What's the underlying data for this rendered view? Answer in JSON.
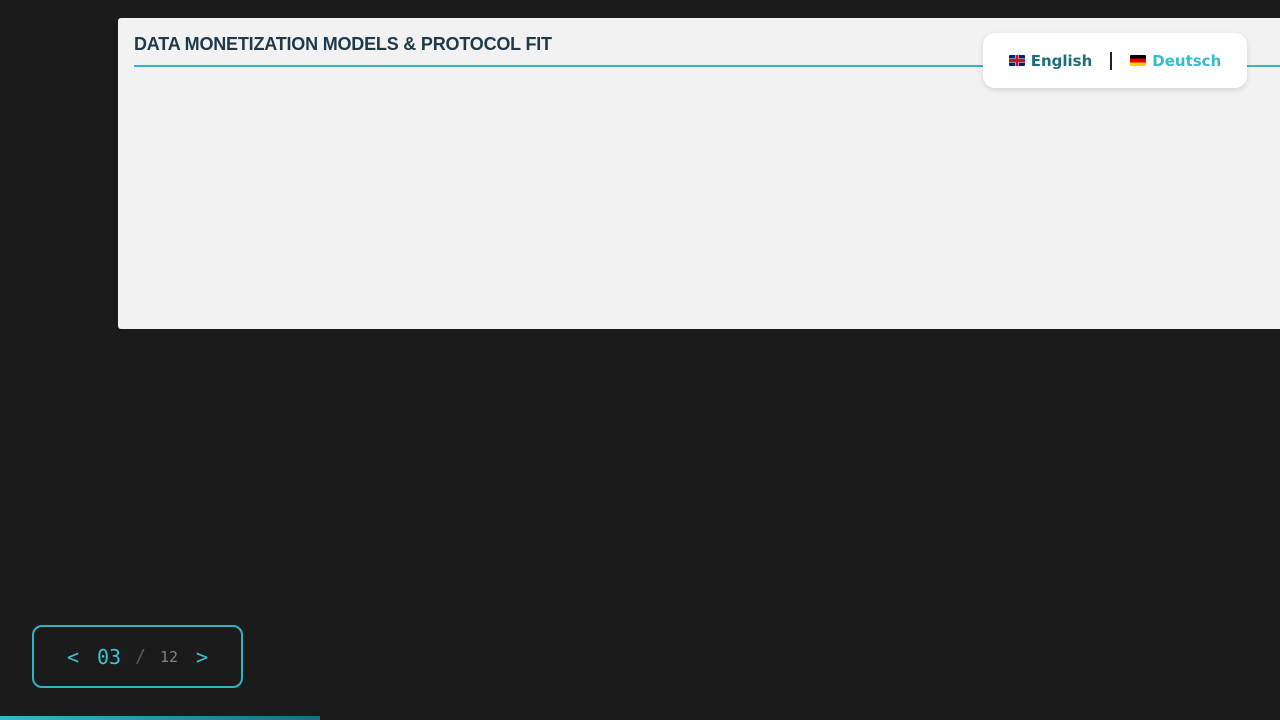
{
  "slide": {
    "title": "DATA MONETIZATION MODELS & PROTOCOL FIT"
  },
  "language_switch": {
    "options": [
      {
        "flag": "uk-flag-icon",
        "label": "English",
        "active": true
      },
      {
        "flag": "de-flag-icon",
        "label": "Deutsch",
        "active": false
      }
    ]
  },
  "pager": {
    "prev_label": "<",
    "next_label": ">",
    "current": "03",
    "separator": "/",
    "total": "12"
  },
  "progress": {
    "fraction": 0.25
  },
  "colors": {
    "accent": "#35b3c8",
    "background": "#1b1b1b",
    "panel": "#f2f2f2",
    "title": "#1e3a4a"
  }
}
